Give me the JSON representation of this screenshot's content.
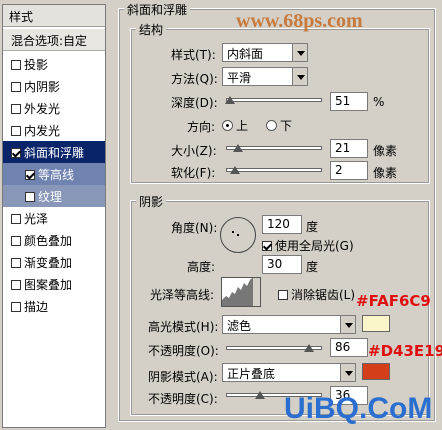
{
  "watermark_top": "www.68ps.com",
  "watermark_bottom": "UiBQ.CoM",
  "left_panel": {
    "header": "样式",
    "items": [
      {
        "label": "混合选项:自定",
        "checkbox": false,
        "checked": false
      },
      {
        "label": "投影",
        "checkbox": true,
        "checked": false
      },
      {
        "label": "内阴影",
        "checkbox": true,
        "checked": false
      },
      {
        "label": "外发光",
        "checkbox": true,
        "checked": false
      },
      {
        "label": "内发光",
        "checkbox": true,
        "checked": false
      },
      {
        "label": "斜面和浮雕",
        "checkbox": true,
        "checked": true
      },
      {
        "label": "等高线",
        "checkbox": true,
        "checked": true
      },
      {
        "label": "纹理",
        "checkbox": true,
        "checked": false
      },
      {
        "label": "光泽",
        "checkbox": true,
        "checked": false
      },
      {
        "label": "颜色叠加",
        "checkbox": true,
        "checked": false
      },
      {
        "label": "渐变叠加",
        "checkbox": true,
        "checked": false
      },
      {
        "label": "图案叠加",
        "checkbox": true,
        "checked": false
      },
      {
        "label": "描边",
        "checkbox": true,
        "checked": false
      }
    ]
  },
  "bevel": {
    "title": "斜面和浮雕",
    "structure_title": "结构",
    "style_label": "样式(T):",
    "style_value": "内斜面",
    "technique_label": "方法(Q):",
    "technique_value": "平滑",
    "depth_label": "深度(D):",
    "depth_value": "51",
    "depth_unit": "%",
    "direction_label": "方向:",
    "dir_up": "上",
    "dir_down": "下",
    "size_label": "大小(Z):",
    "size_value": "21",
    "size_unit": "像素",
    "soften_label": "软化(F):",
    "soften_value": "2",
    "soften_unit": "像素"
  },
  "shading": {
    "title": "阴影",
    "angle_label": "角度(N):",
    "angle_value": "120",
    "angle_unit": "度",
    "global_light_label": "使用全局光(G)",
    "altitude_label": "高度:",
    "altitude_value": "30",
    "altitude_unit": "度",
    "gloss_label": "光泽等高线:",
    "antialias_label": "消除锯齿(L)",
    "highlight_mode_label": "高光模式(H):",
    "highlight_mode_value": "滤色",
    "highlight_color": "#FAF6C9",
    "highlight_annot": "#FAF6C9",
    "opacity1_label": "不透明度(O):",
    "opacity1_value": "86",
    "shadow_mode_label": "阴影模式(A):",
    "shadow_mode_value": "正片叠底",
    "shadow_color": "#D43E19",
    "shadow_annot": "#D43E19",
    "opacity2_label": "不透明度(C):",
    "opacity2_value": "36"
  }
}
